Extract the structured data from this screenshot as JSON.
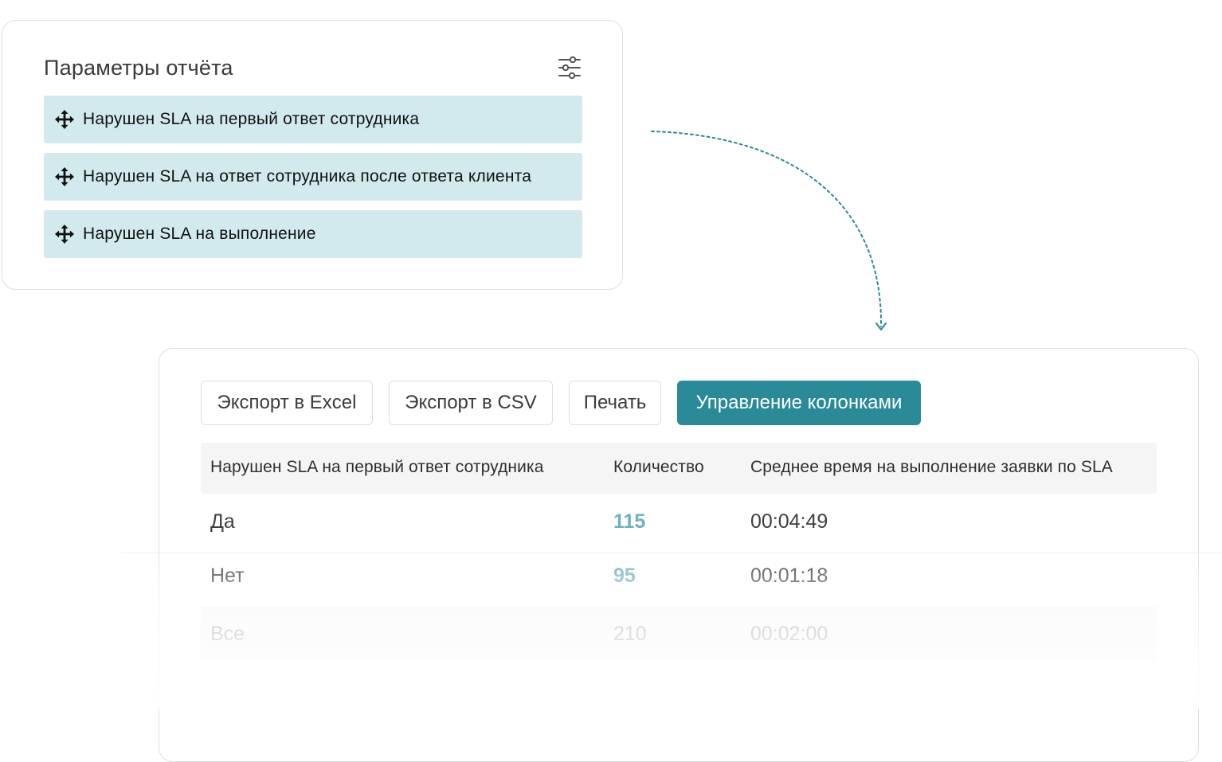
{
  "params_panel": {
    "title": "Параметры отчёта",
    "settings_icon": "sliders-icon",
    "items": [
      {
        "label": "Нарушен SLA на первый ответ сотрудника",
        "icon": "move-icon"
      },
      {
        "label": "Нарушен SLA на ответ сотрудника после ответа клиента",
        "icon": "move-icon"
      },
      {
        "label": "Нарушен SLA на выполнение",
        "icon": "move-icon"
      }
    ]
  },
  "toolbar": {
    "export_excel": "Экспорт в Excel",
    "export_csv": "Экспорт в CSV",
    "print": "Печать",
    "manage_columns": "Управление колонками"
  },
  "table": {
    "headers": [
      "Нарушен SLA на первый ответ сотрудника",
      "Количество",
      "Среднее время на выполнение заявки по SLA"
    ],
    "rows": [
      {
        "label": "Да",
        "count": "115",
        "avg_time": "00:04:49"
      },
      {
        "label": "Нет",
        "count": "95",
        "avg_time": "00:01:18"
      }
    ],
    "total": {
      "label": "Все",
      "count": "210",
      "avg_time": "00:02:00"
    }
  },
  "colors": {
    "accent": "#2b8a98",
    "param_item_bg": "#d2eaee",
    "link": "#6fb2be",
    "border": "#dedede"
  }
}
